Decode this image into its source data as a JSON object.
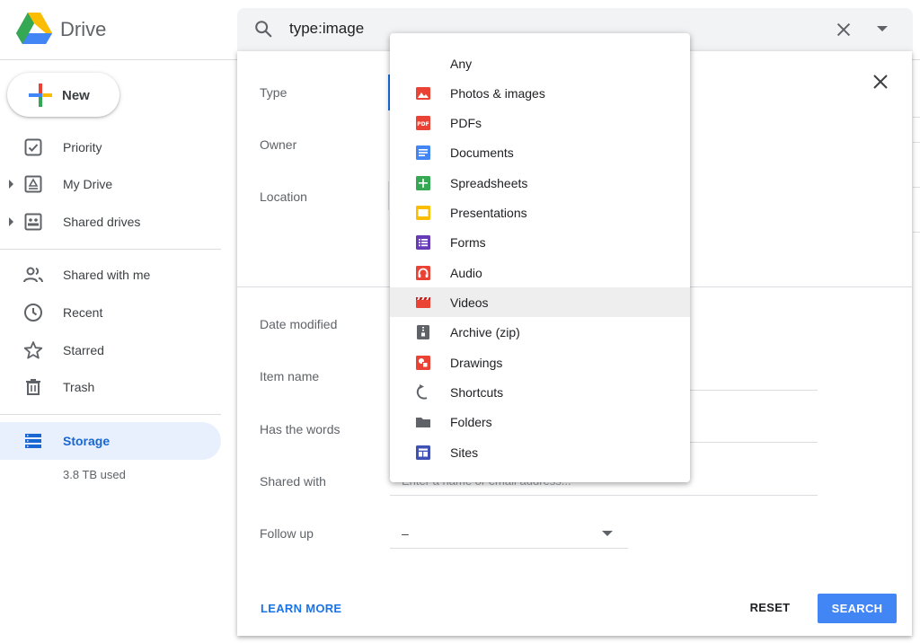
{
  "header": {
    "brand": "Drive",
    "search_query": "type:image"
  },
  "sidebar": {
    "new_label": "New",
    "items": [
      {
        "label": "Priority"
      },
      {
        "label": "My Drive"
      },
      {
        "label": "Shared drives"
      },
      {
        "label": "Shared with me"
      },
      {
        "label": "Recent"
      },
      {
        "label": "Starred"
      },
      {
        "label": "Trash"
      }
    ],
    "storage_label": "Storage",
    "storage_used": "3.8 TB used"
  },
  "panel": {
    "fields": {
      "type": "Type",
      "owner": "Owner",
      "location": "Location",
      "date_modified": "Date modified",
      "item_name": "Item name",
      "has_words": "Has the words",
      "shared_with": "Shared with",
      "follow_up": "Follow up"
    },
    "shared_with_placeholder": "Enter a name or email address...",
    "follow_up_value": "–",
    "learn_more": "LEARN MORE",
    "reset": "RESET",
    "search": "SEARCH"
  },
  "type_dropdown": {
    "options": [
      {
        "label": "Any",
        "icon": "none"
      },
      {
        "label": "Photos & images",
        "icon": "image-icon",
        "color": "#ea4335"
      },
      {
        "label": "PDFs",
        "icon": "pdf-icon",
        "color": "#ea4335"
      },
      {
        "label": "Documents",
        "icon": "document-icon",
        "color": "#4285f4"
      },
      {
        "label": "Spreadsheets",
        "icon": "spreadsheet-icon",
        "color": "#34a853"
      },
      {
        "label": "Presentations",
        "icon": "presentation-icon",
        "color": "#fbbc04"
      },
      {
        "label": "Forms",
        "icon": "form-icon",
        "color": "#673ab7"
      },
      {
        "label": "Audio",
        "icon": "audio-icon",
        "color": "#ea4335"
      },
      {
        "label": "Videos",
        "icon": "video-icon",
        "color": "#ea4335"
      },
      {
        "label": "Archive (zip)",
        "icon": "archive-icon",
        "color": "#5f6368"
      },
      {
        "label": "Drawings",
        "icon": "drawing-icon",
        "color": "#ea4335"
      },
      {
        "label": "Shortcuts",
        "icon": "shortcut-icon",
        "color": "#5f6368"
      },
      {
        "label": "Folders",
        "icon": "folder-icon",
        "color": "#5f6368"
      },
      {
        "label": "Sites",
        "icon": "sites-icon",
        "color": "#3f51b5"
      }
    ],
    "highlighted": "Videos"
  }
}
